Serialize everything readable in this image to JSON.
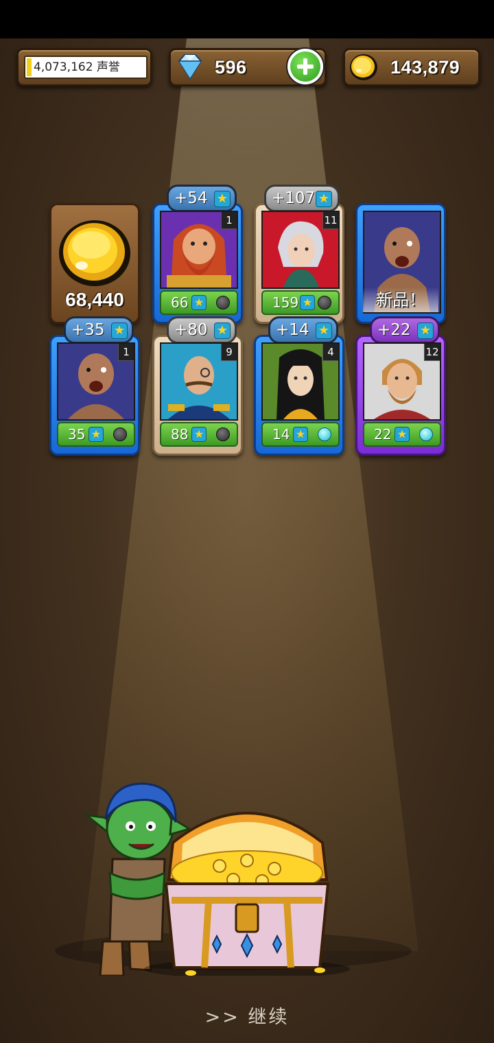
{
  "header": {
    "reputation_text": "4,073,162 声誉",
    "reputation_progress": 0.04,
    "gems": "596",
    "gold": "143,879",
    "gem_icon": "diamond-icon",
    "gold_icon": "gold-coin-icon",
    "add_icon": "plus-icon"
  },
  "reward_gold": {
    "amount": "68,440",
    "icon": "gold-coin-icon"
  },
  "cards": [
    {
      "name": "red-bearded-dwarf",
      "frame": "blue",
      "level": "1",
      "bonus": "+54",
      "badge": "blue",
      "stars": "66",
      "dot": "grey"
    },
    {
      "name": "white-haired-elf",
      "frame": "tan",
      "level": "11",
      "bonus": "+107",
      "badge": "grey",
      "stars": "159",
      "dot": "grey"
    },
    {
      "name": "orc-warrior-new",
      "frame": "blue",
      "new_label": "新品！"
    },
    {
      "name": "orc-warrior",
      "frame": "blue",
      "level": "1",
      "bonus": "+35",
      "badge": "blue",
      "stars": "35",
      "dot": "grey"
    },
    {
      "name": "monocle-general",
      "frame": "tan",
      "level": "9",
      "bonus": "+80",
      "badge": "grey",
      "stars": "88",
      "dot": "grey"
    },
    {
      "name": "black-haired-lady",
      "frame": "blue",
      "level": "4",
      "bonus": "+14",
      "badge": "blue",
      "stars": "14",
      "dot": "cyan"
    },
    {
      "name": "bearded-lumberjack",
      "frame": "purple",
      "level": "12",
      "bonus": "+22",
      "badge": "purple",
      "stars": "22",
      "dot": "cyan"
    }
  ],
  "colors": {
    "background": "#43311f",
    "blue_frame": "#1768d4",
    "tan_frame": "#cdb08c",
    "purple_frame": "#7a2ed2",
    "stat_green": "#3e9a24"
  },
  "footer": {
    "continue_label": ">> 继续"
  }
}
